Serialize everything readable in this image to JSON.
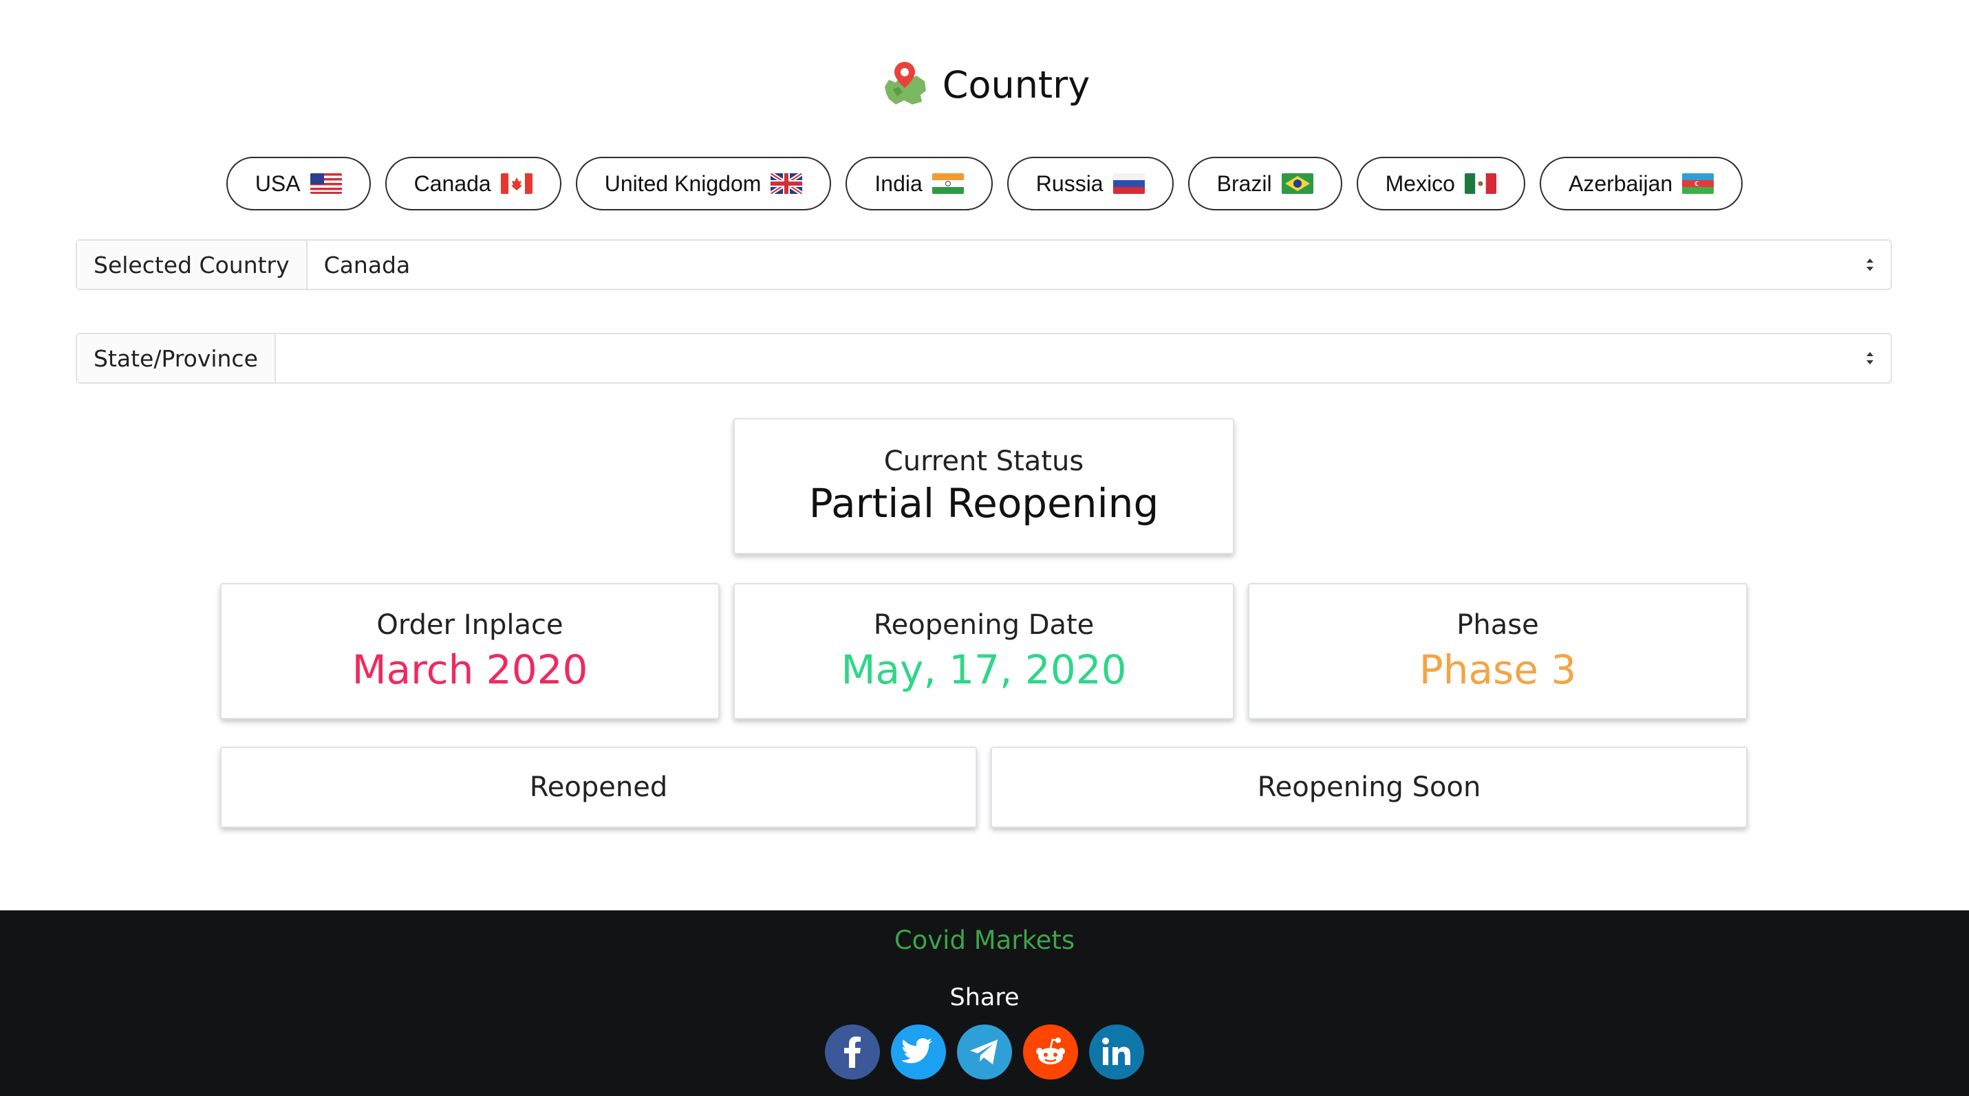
{
  "header": {
    "title": "Country",
    "icon": "map-pin-icon"
  },
  "countries": [
    {
      "label": "USA",
      "flag": "us-flag-icon"
    },
    {
      "label": "Canada",
      "flag": "canada-flag-icon"
    },
    {
      "label": "United Knigdom",
      "flag": "uk-flag-icon"
    },
    {
      "label": "India",
      "flag": "india-flag-icon"
    },
    {
      "label": "Russia",
      "flag": "russia-flag-icon"
    },
    {
      "label": "Brazil",
      "flag": "brazil-flag-icon"
    },
    {
      "label": "Mexico",
      "flag": "mexico-flag-icon"
    },
    {
      "label": "Azerbaijan",
      "flag": "azerbaijan-flag-icon"
    }
  ],
  "selected_country": {
    "label": "Selected Country",
    "value": "Canada"
  },
  "state_province": {
    "label": "State/Province",
    "value": ""
  },
  "current_status": {
    "title": "Current Status",
    "value": "Partial Reopening"
  },
  "stats": {
    "order": {
      "title": "Order Inplace",
      "value": "March 2020",
      "color": "#ee2a5f"
    },
    "reopening_date": {
      "title": "Reopening Date",
      "value": "May, 17, 2020",
      "color": "#2fd687"
    },
    "phase": {
      "title": "Phase",
      "value": "Phase 3",
      "color": "#f4a445"
    }
  },
  "buttons": {
    "reopened": "Reopened",
    "reopening_soon": "Reopening Soon"
  },
  "footer": {
    "brand": "Covid Markets",
    "share_label": "Share",
    "social": [
      {
        "name": "facebook-icon",
        "color": "#3b5998"
      },
      {
        "name": "twitter-icon",
        "color": "#1da1f2"
      },
      {
        "name": "telegram-icon",
        "color": "#2f9fd8"
      },
      {
        "name": "reddit-icon",
        "color": "#ff4500"
      },
      {
        "name": "linkedin-icon",
        "color": "#0e76a8"
      }
    ]
  }
}
